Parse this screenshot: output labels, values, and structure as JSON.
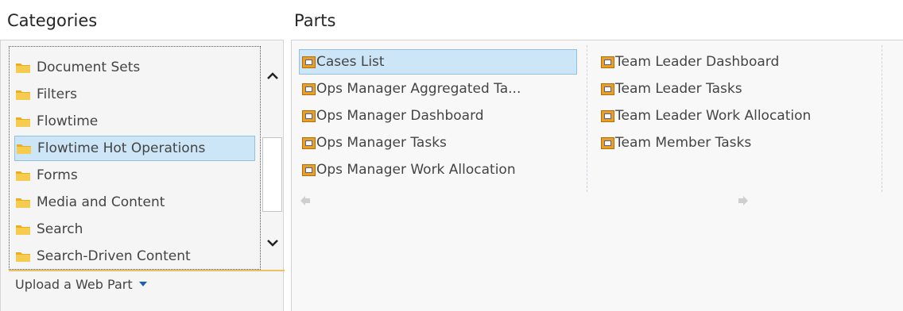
{
  "categories": {
    "heading": "Categories",
    "items": [
      {
        "label": "Document Sets",
        "selected": false
      },
      {
        "label": "Filters",
        "selected": false
      },
      {
        "label": "Flowtime",
        "selected": false
      },
      {
        "label": "Flowtime Hot Operations",
        "selected": true
      },
      {
        "label": "Forms",
        "selected": false
      },
      {
        "label": "Media and Content",
        "selected": false
      },
      {
        "label": "Search",
        "selected": false
      },
      {
        "label": "Search-Driven Content",
        "selected": false
      }
    ],
    "upload_label": "Upload a Web Part"
  },
  "parts": {
    "heading": "Parts",
    "columns": [
      [
        "Cases List",
        "Ops Manager Aggregated Ta...",
        "Ops Manager Dashboard",
        "Ops Manager Tasks",
        "Ops Manager Work Allocation"
      ],
      [
        "Team Leader Dashboard",
        "Team Leader Tasks",
        "Team Leader Work Allocation",
        "Team Member Tasks"
      ]
    ],
    "selected": "Cases List"
  },
  "colors": {
    "selection_bg": "#cde6f7",
    "folder": "#e8b020",
    "accent_line": "#f0c060"
  },
  "icons": {
    "scroll_up": "chevron-up-icon",
    "scroll_down": "chevron-down-icon",
    "upload_dropdown": "triangle-down-icon",
    "prev_page": "arrow-left-icon",
    "next_page": "arrow-right-icon"
  }
}
